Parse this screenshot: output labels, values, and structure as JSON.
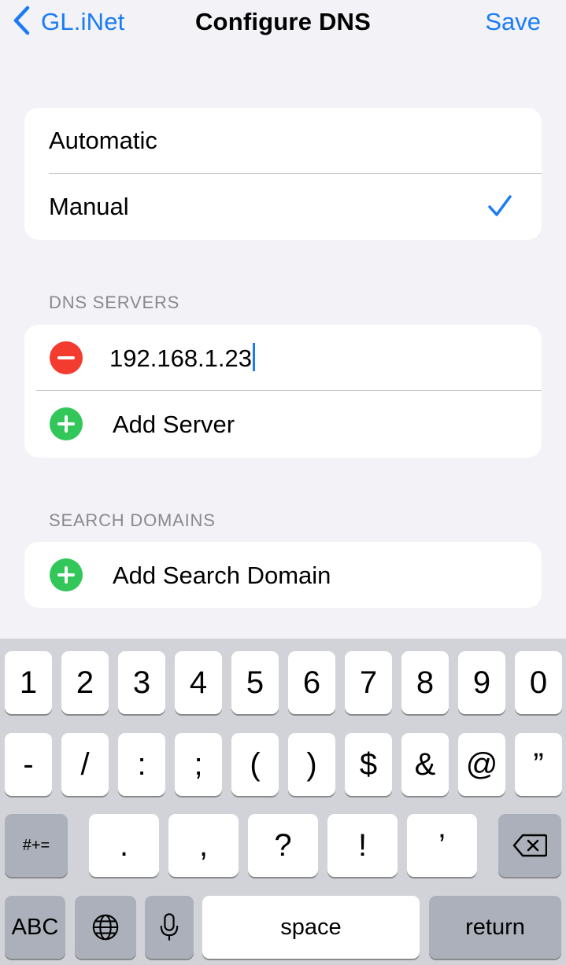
{
  "nav": {
    "back_label": "GL.iNet",
    "title": "Configure DNS",
    "save_label": "Save"
  },
  "mode": {
    "options": [
      {
        "label": "Automatic",
        "selected": false
      },
      {
        "label": "Manual",
        "selected": true
      }
    ]
  },
  "dns_servers": {
    "header": "DNS SERVERS",
    "servers": [
      "192.168.1.23"
    ],
    "add_label": "Add Server"
  },
  "search_domains": {
    "header": "SEARCH DOMAINS",
    "add_label": "Add Search Domain"
  },
  "keyboard": {
    "row1": [
      "1",
      "2",
      "3",
      "4",
      "5",
      "6",
      "7",
      "8",
      "9",
      "0"
    ],
    "row2": [
      "-",
      "/",
      ":",
      ";",
      "(",
      ")",
      "$",
      "&",
      "@",
      "”"
    ],
    "row3_mode": "#+=",
    "row3": [
      ".",
      ",",
      "?",
      "!",
      "’"
    ],
    "row4_abc": "ABC",
    "space_label": "space",
    "return_label": "return"
  },
  "colors": {
    "accent": "#1a7cf5",
    "delete_red": "#f33b30",
    "add_green": "#33c759",
    "background": "#f2f2f7"
  }
}
